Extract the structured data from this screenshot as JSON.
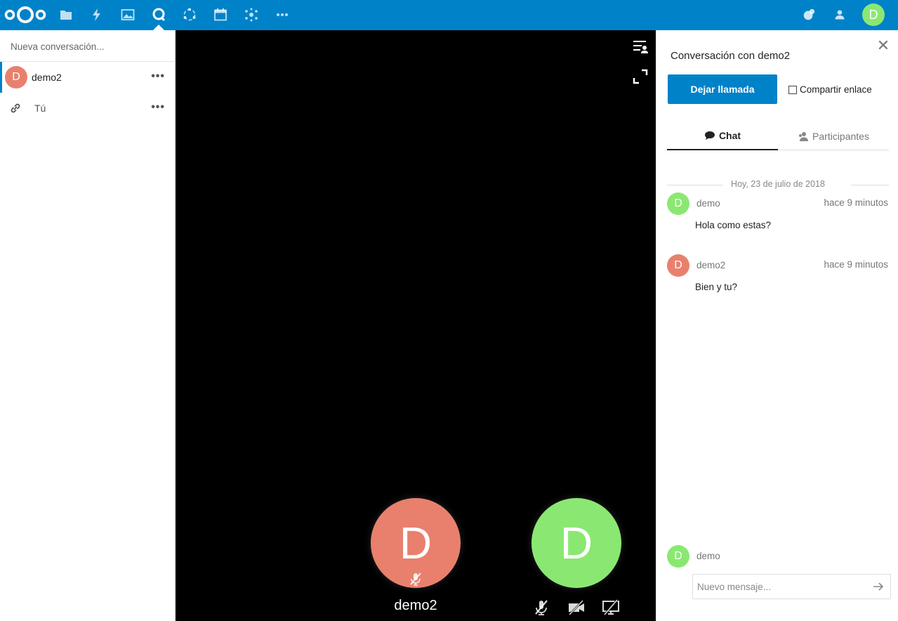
{
  "header": {
    "apps": [
      {
        "name": "files-icon"
      },
      {
        "name": "activity-icon"
      },
      {
        "name": "gallery-icon"
      },
      {
        "name": "talk-icon"
      },
      {
        "name": "circles-icon"
      },
      {
        "name": "calendar-icon"
      },
      {
        "name": "social-icon"
      },
      {
        "name": "more-apps-icon"
      }
    ],
    "user_initial": "D",
    "brand_color": "#0082c9"
  },
  "sidebar": {
    "new_conversation_placeholder": "Nueva conversación...",
    "conversations": [
      {
        "initial": "D",
        "name": "demo2",
        "avatar_color": "#e9806e",
        "active": true
      },
      {
        "name": "Tú",
        "icon": "link-icon",
        "active": false
      }
    ]
  },
  "video": {
    "remote": {
      "initial": "D",
      "name": "demo2",
      "color": "#e9806e",
      "muted": true
    },
    "local": {
      "initial": "D",
      "color": "#8ae872"
    }
  },
  "right": {
    "title": "Conversación con demo2",
    "leave_button": "Dejar llamada",
    "share_link_label": "Compartir enlace",
    "share_link_checked": false,
    "tabs": [
      {
        "label": "Chat",
        "icon": "chat-bubble-icon",
        "active": true
      },
      {
        "label": "Participantes",
        "icon": "participants-icon",
        "active": false
      }
    ],
    "date_separator": "Hoy, 23 de julio de 2018",
    "messages": [
      {
        "initial": "D",
        "author": "demo",
        "time": "hace 9 minutos",
        "text": "Hola como estas?",
        "color": "#8ae872"
      },
      {
        "initial": "D",
        "author": "demo2",
        "time": "hace 9 minutos",
        "text": "Bien y tu?",
        "color": "#e9806e"
      }
    ],
    "composer": {
      "initial": "D",
      "author": "demo",
      "placeholder": "Nuevo mensaje..."
    }
  }
}
